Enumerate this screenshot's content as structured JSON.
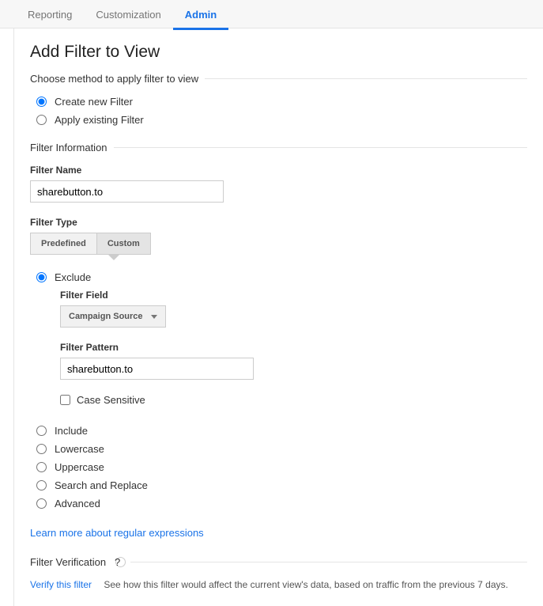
{
  "tabs": {
    "reporting": "Reporting",
    "customization": "Customization",
    "admin": "Admin"
  },
  "title": "Add Filter to View",
  "methodSection": "Choose method to apply filter to view",
  "method": {
    "createNew": "Create new Filter",
    "applyExisting": "Apply existing Filter"
  },
  "infoSection": "Filter Information",
  "filterNameLabel": "Filter Name",
  "filterNameValue": "sharebutton.to",
  "filterTypeLabel": "Filter Type",
  "typeToggle": {
    "predefined": "Predefined",
    "custom": "Custom"
  },
  "customOptions": {
    "exclude": "Exclude",
    "include": "Include",
    "lowercase": "Lowercase",
    "uppercase": "Uppercase",
    "searchReplace": "Search and Replace",
    "advanced": "Advanced"
  },
  "filterFieldLabel": "Filter Field",
  "filterFieldValue": "Campaign Source",
  "filterPatternLabel": "Filter Pattern",
  "filterPatternValue": "sharebutton.to",
  "caseSensitive": "Case Sensitive",
  "learnMore": "Learn more about regular expressions",
  "verificationSection": "Filter Verification",
  "verifyLink": "Verify this filter",
  "verifyDesc": "See how this filter would affect the current view's data, based on traffic from the previous 7 days."
}
